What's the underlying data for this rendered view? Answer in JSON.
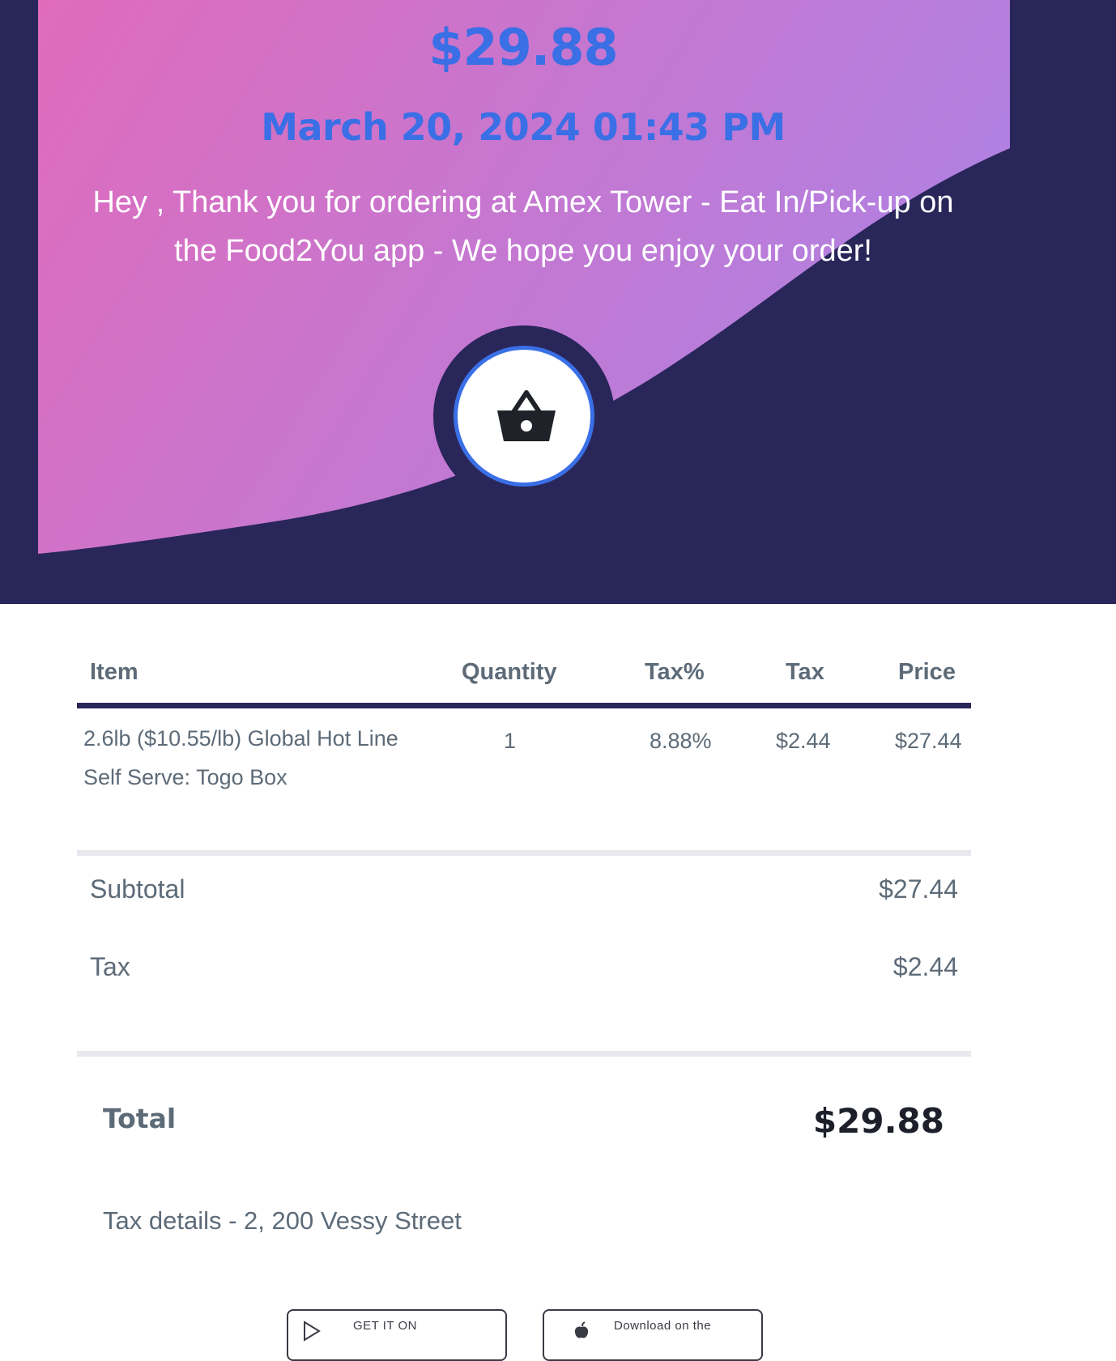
{
  "colors": {
    "hero_bg": "#29265a",
    "gradient_start": "#e06bbb",
    "gradient_end": "#b081e2",
    "accent_blue": "#3a6fe6",
    "text_gray": "#5d6b78"
  },
  "hero": {
    "amount": "$29.88",
    "datetime": "March 20, 2024 01:43 PM",
    "message": "Hey , Thank you for ordering at Amex Tower - Eat In/Pick-up on the Food2You app - We hope you enjoy your order!",
    "badge_icon": "shopping-basket-icon"
  },
  "table": {
    "headers": {
      "item": "Item",
      "quantity": "Quantity",
      "tax_pct": "Tax%",
      "tax": "Tax",
      "price": "Price"
    },
    "rows": [
      {
        "item_line1": "2.6lb ($10.55/lb) Global Hot Line",
        "item_line2": "Self Serve: Togo Box",
        "quantity": "1",
        "tax_pct": "8.88%",
        "tax": "$2.44",
        "price": "$27.44"
      }
    ]
  },
  "summary": {
    "subtotal_label": "Subtotal",
    "subtotal_value": "$27.44",
    "tax_label": "Tax",
    "tax_value": "$2.44",
    "total_label": "Total",
    "total_value": "$29.88",
    "tax_details": "Tax details - 2, 200 Vessy Street"
  },
  "store_buttons": {
    "google_play": "GET IT ON",
    "app_store": "Download on the"
  }
}
